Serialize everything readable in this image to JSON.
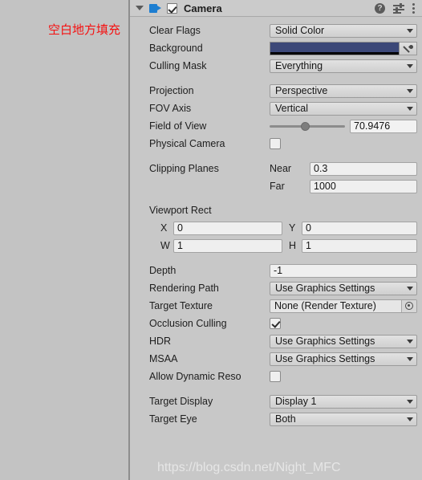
{
  "left_panel": {
    "annotation": "空白地方填充"
  },
  "component_header": {
    "title": "Camera",
    "enabled": true,
    "foldout_icon": "triangle-down-icon",
    "component_icon": "camera-icon",
    "help_icon": "?",
    "preset_icon": "preset-sliders-icon",
    "menu_icon": "kebab-menu-icon"
  },
  "fields": {
    "clear_flags": {
      "label": "Clear Flags",
      "value": "Solid Color"
    },
    "background": {
      "label": "Background",
      "color": "#3c4878",
      "alpha_color": "#000000",
      "picker_icon": "eyedropper-icon"
    },
    "culling_mask": {
      "label": "Culling Mask",
      "value": "Everything"
    },
    "projection": {
      "label": "Projection",
      "value": "Perspective"
    },
    "fov_axis": {
      "label": "FOV Axis",
      "value": "Vertical"
    },
    "field_of_view": {
      "label": "Field of View",
      "value": "70.9476",
      "slider_percent": 47
    },
    "physical_camera": {
      "label": "Physical Camera",
      "checked": false
    },
    "clipping_planes": {
      "label": "Clipping Planes",
      "near_label": "Near",
      "near_value": "0.3",
      "far_label": "Far",
      "far_value": "1000"
    },
    "viewport_rect": {
      "label": "Viewport Rect",
      "x_label": "X",
      "x_value": "0",
      "y_label": "Y",
      "y_value": "0",
      "w_label": "W",
      "w_value": "1",
      "h_label": "H",
      "h_value": "1"
    },
    "depth": {
      "label": "Depth",
      "value": "-1"
    },
    "rendering_path": {
      "label": "Rendering Path",
      "value": "Use Graphics Settings"
    },
    "target_texture": {
      "label": "Target Texture",
      "value": "None (Render Texture)",
      "picker_icon": "object-picker-icon"
    },
    "occlusion_culling": {
      "label": "Occlusion Culling",
      "checked": true
    },
    "hdr": {
      "label": "HDR",
      "value": "Use Graphics Settings"
    },
    "msaa": {
      "label": "MSAA",
      "value": "Use Graphics Settings"
    },
    "allow_dynamic_resolution": {
      "label": "Allow Dynamic Reso",
      "checked": false
    },
    "target_display": {
      "label": "Target Display",
      "value": "Display 1"
    },
    "target_eye": {
      "label": "Target Eye",
      "value": "Both"
    }
  },
  "watermark": {
    "text": "https://blog.csdn.net/Night_MFC"
  }
}
